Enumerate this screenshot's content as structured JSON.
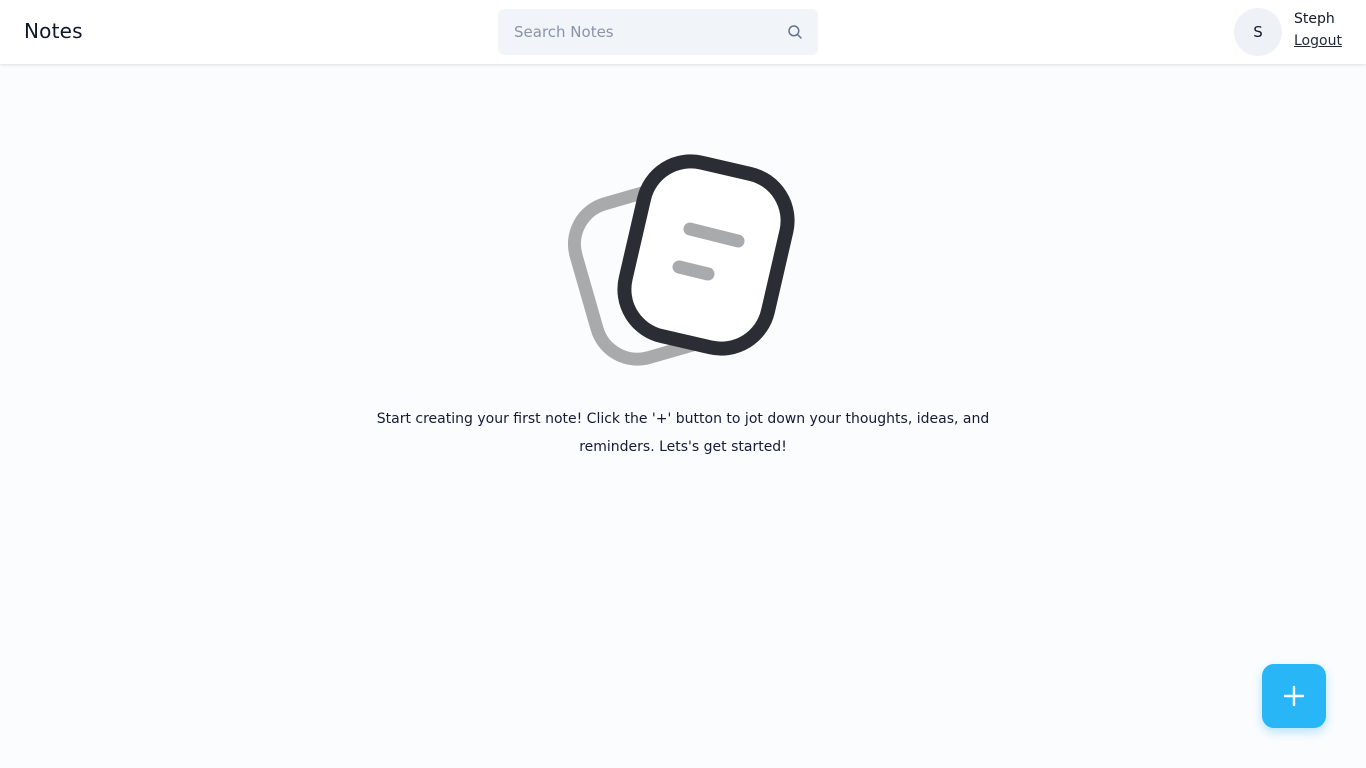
{
  "header": {
    "app_title": "Notes",
    "search": {
      "placeholder": "Search Notes",
      "value": ""
    },
    "user": {
      "avatar_initial": "S",
      "name": "Steph",
      "logout_label": "Logout"
    }
  },
  "main": {
    "empty_state": {
      "illustration_icon": "notes-stack-icon",
      "message": "Start creating your first note! Click the '+' button to jot down your thoughts, ideas, and reminders. Lets's get started!"
    }
  },
  "fab": {
    "icon": "plus-icon"
  },
  "colors": {
    "accent": "#29b6f6",
    "topbar_bg": "#ffffff",
    "page_bg": "#fbfcfe",
    "search_bg": "#f1f4f8",
    "illustration_dark": "#2a2d33",
    "illustration_light": "#a9aaac"
  }
}
